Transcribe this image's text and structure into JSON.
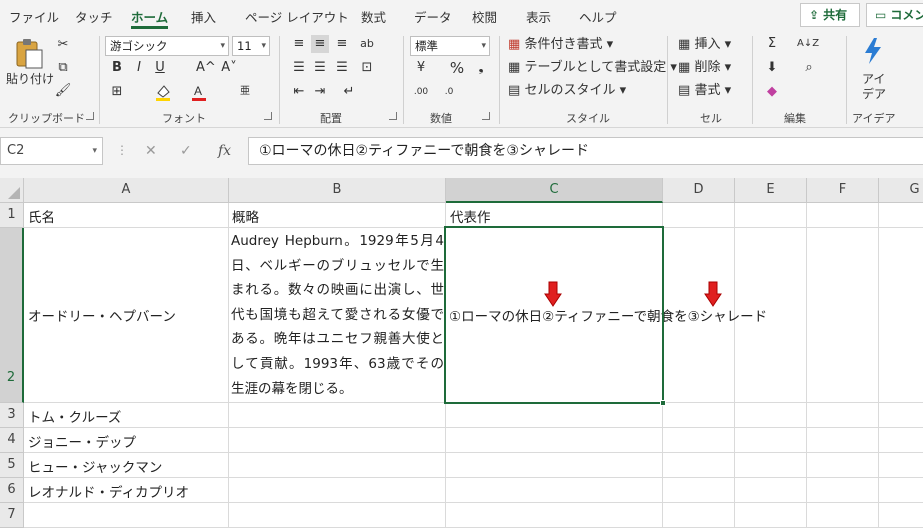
{
  "ribbon_tabs": [
    "ファイル",
    "タッチ",
    "ホーム",
    "挿入",
    "ページ レイアウト",
    "数式",
    "データ",
    "校閲",
    "表示",
    "ヘルプ"
  ],
  "active_tab": "ホーム",
  "share_label": "共有",
  "comment_label": "コメント",
  "clipboard": {
    "paste": "貼り付け",
    "group": "クリップボード"
  },
  "font": {
    "name": "游ゴシック",
    "size": "11",
    "group": "フォント",
    "bold": "B",
    "italic": "I",
    "underline": "U",
    "grow": "A^",
    "shrink": "A˅",
    "phonetic": "亜"
  },
  "alignment": {
    "group": "配置"
  },
  "number": {
    "format": "標準",
    "group": "数値",
    "percent": "%"
  },
  "styles": {
    "conditional": "条件付き書式",
    "table": "テーブルとして書式設定",
    "cell_styles": "セルのスタイル",
    "group": "スタイル"
  },
  "cells": {
    "insert": "挿入",
    "delete": "削除",
    "format": "書式",
    "group": "セル"
  },
  "editing": {
    "group": "編集"
  },
  "ideas": {
    "label": "アイ\nデア",
    "label_line1": "アイ",
    "label_line2": "デア",
    "group": "アイデア"
  },
  "formula_bar": {
    "name_box": "C2",
    "fx": "fx",
    "content": "①ローマの休日②ティファニーで朝食を③シャレード"
  },
  "columns": [
    "A",
    "B",
    "C",
    "D",
    "E",
    "F",
    "G"
  ],
  "rows": [
    "1",
    "2",
    "3",
    "4",
    "5",
    "6",
    "7"
  ],
  "sheet": {
    "A1": "氏名",
    "B1": "概略",
    "C1": "代表作",
    "A2": "オードリー・ヘプバーン",
    "B2": "Audrey Hepburn。1929年5月4日、ベルギーのブリュッセルで生まれる。数々の映画に出演し、世代も国境も超えて愛される女優である。晩年はユニセフ親善大使として貢献。1993年、63歳でその生涯の幕を閉じる。",
    "C2": "①ローマの休日②ティファニーで朝食を③シャレード",
    "A3": "トム・クルーズ",
    "A4": "ジョニー・デップ",
    "A5": "ヒュー・ジャックマン",
    "A6": "レオナルド・ディカプリオ"
  },
  "selected_cell": "C2",
  "colors": {
    "accent": "#1e6b3a",
    "annotation_arrow": "#e02020"
  }
}
